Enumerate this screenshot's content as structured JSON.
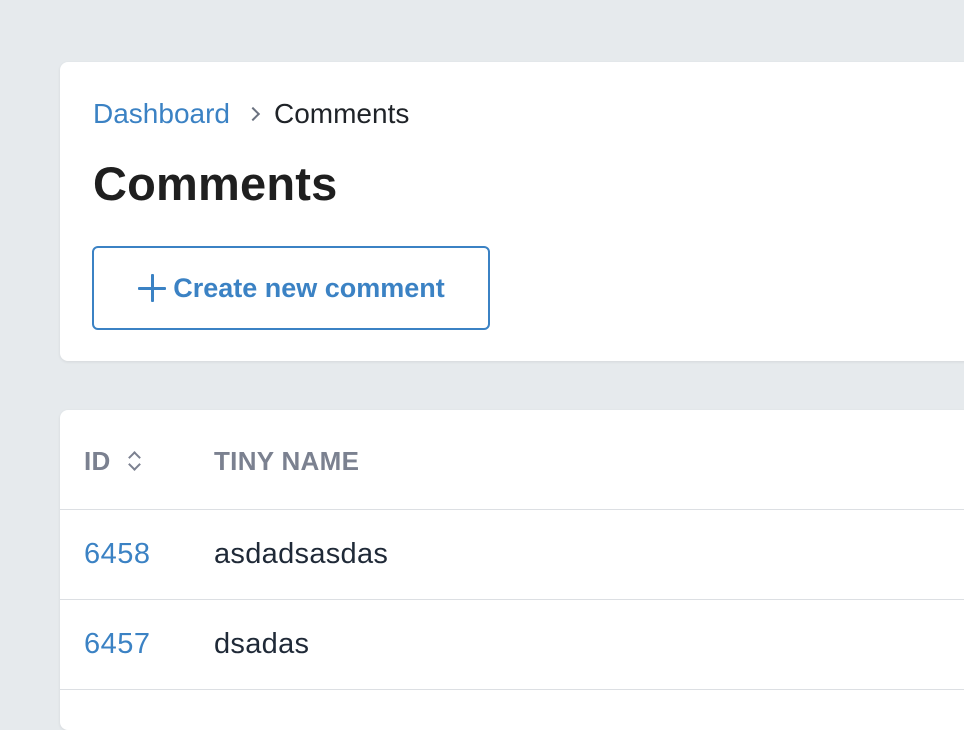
{
  "breadcrumb": {
    "items": [
      {
        "label": "Dashboard"
      },
      {
        "label": "Comments"
      }
    ]
  },
  "page": {
    "title": "Comments",
    "create_button_label": "Create new comment"
  },
  "table": {
    "columns": [
      {
        "label": "ID",
        "sortable": true
      },
      {
        "label": "TINY NAME",
        "sortable": false
      }
    ],
    "rows": [
      {
        "id": "6458",
        "tiny_name": "asdadsasdas"
      },
      {
        "id": "6457",
        "tiny_name": "dsadas"
      }
    ]
  },
  "colors": {
    "accent": "#3b82c4",
    "background": "#e6eaed",
    "card": "#ffffff",
    "text_primary": "#1f1f1f",
    "text_muted": "#7b8190",
    "divider": "#dcdfe3"
  },
  "icons": {
    "breadcrumb_separator": "chevron-right-icon",
    "create_button": "plus-icon",
    "sort": "sort-icon"
  }
}
